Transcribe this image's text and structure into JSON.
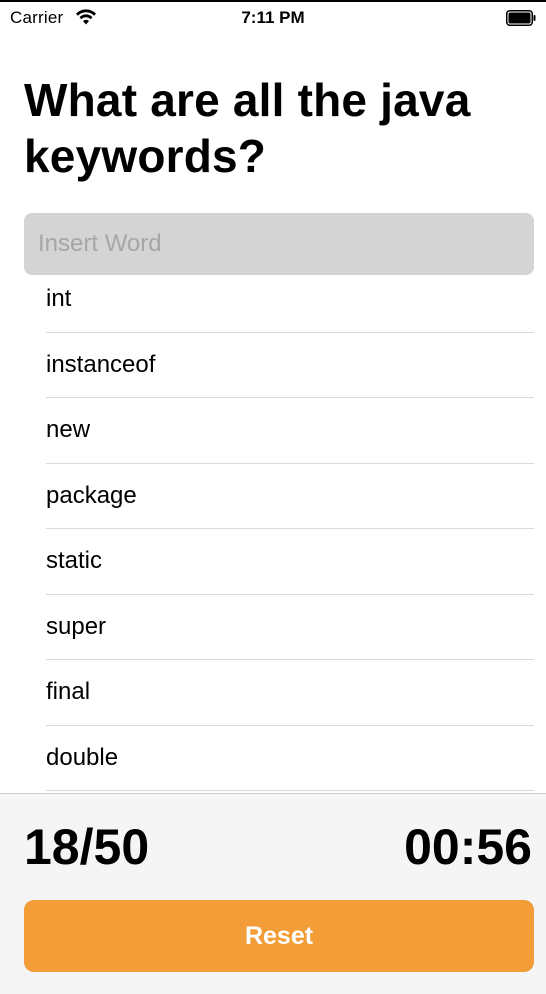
{
  "status_bar": {
    "carrier": "Carrier",
    "time": "7:11 PM",
    "wifi_icon": "wifi-icon",
    "battery_icon": "battery-full-icon"
  },
  "header": {
    "title": "What are all the java keywords?"
  },
  "search": {
    "placeholder": "Insert Word",
    "value": ""
  },
  "words": [
    "int",
    "instanceof",
    "new",
    "package",
    "static",
    "super",
    "final",
    "double"
  ],
  "footer": {
    "score": "18/50",
    "timer": "00:56",
    "reset_label": "Reset"
  },
  "colors": {
    "accent": "#f29d38",
    "search_background": "#d4d4d4",
    "footer_background": "#f5f5f5"
  }
}
